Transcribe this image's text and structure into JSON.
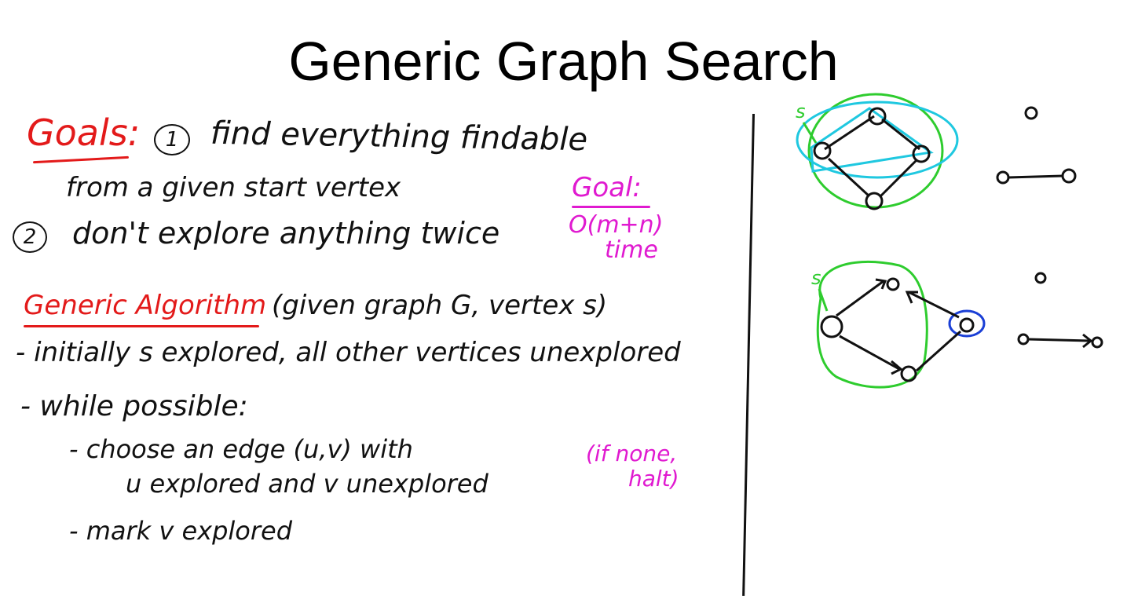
{
  "title": "Generic Graph Search",
  "goals": {
    "heading": "Goals:",
    "goal1_number": "1",
    "goal1_line1": "find everything findable",
    "goal1_line2": "from a given start vertex",
    "goal2_number": "2",
    "goal2_line1": "don't explore anything twice",
    "side_heading": "Goal:",
    "side_line1": "O(m+n)",
    "side_line2": "time"
  },
  "algorithm": {
    "heading": "Generic Algorithm",
    "heading_note": "(given graph G, vertex s)",
    "step1": "- initially s explored, all other vertices unexplored",
    "step2": "- while possible:",
    "step2a_line1": "- choose an edge (u,v) with",
    "step2a_line2": "u explored and v unexplored",
    "step2a_note_line1": "(if none,",
    "step2a_note_line2": "halt)",
    "step2b": "- mark v explored"
  },
  "graphs": {
    "top_start_label": "s",
    "bottom_start_label": "s"
  },
  "colors": {
    "ink": "#111111",
    "red": "#e31a1a",
    "magenta": "#e01ad0",
    "green": "#2ecc2e",
    "cyan": "#1fc8e0",
    "blue": "#1a3fd6"
  }
}
